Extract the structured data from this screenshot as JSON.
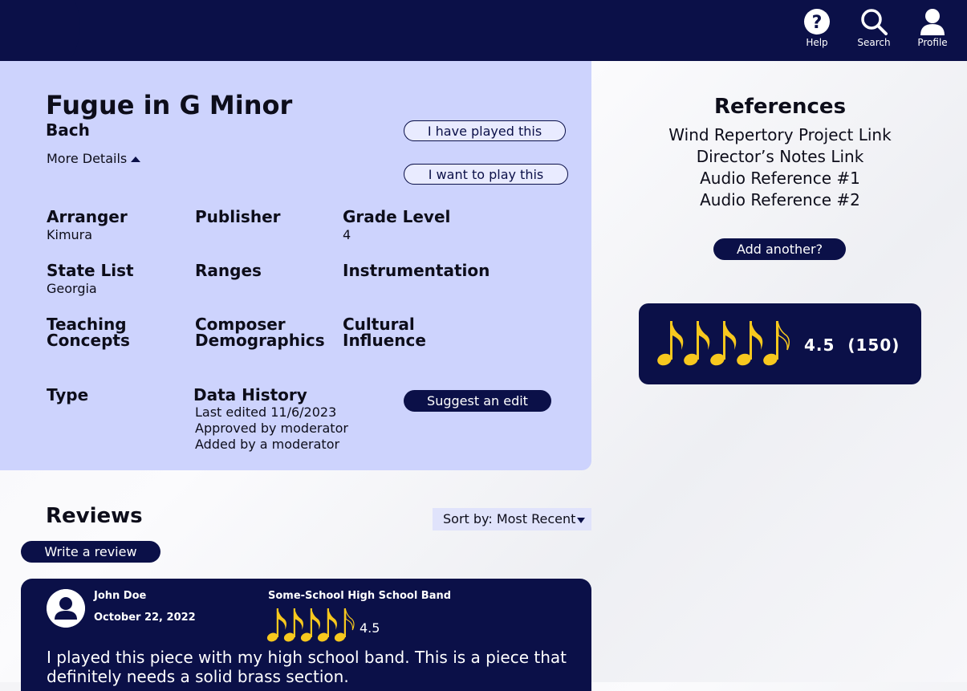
{
  "nav": {
    "help": "Help",
    "search": "Search",
    "profile": "Profile"
  },
  "piece": {
    "title": "Fugue in G Minor",
    "composer": "Bach",
    "more_details": "More Details",
    "played_label": "I have played this",
    "want_label": "I want to play this"
  },
  "fields": {
    "arranger": {
      "label": "Arranger",
      "value": "Kimura"
    },
    "publisher": {
      "label": "Publisher",
      "value": ""
    },
    "grade": {
      "label": "Grade Level",
      "value": "4"
    },
    "state_list": {
      "label": "State List",
      "value": "Georgia"
    },
    "ranges": {
      "label": "Ranges",
      "value": ""
    },
    "instrumentation": {
      "label": "Instrumentation",
      "value": ""
    },
    "teaching_line1": "Teaching",
    "teaching_line2": "Concepts",
    "composer_demo_line1": "Composer",
    "composer_demo_line2": "Demographics",
    "cultural_line1": "Cultural",
    "cultural_line2": "Influence",
    "type": {
      "label": "Type",
      "value": ""
    },
    "data_history": {
      "label": "Data History",
      "lines": [
        "Last edited 11/6/2023",
        "Approved by moderator",
        "Added by a moderator"
      ]
    },
    "suggest_edit": "Suggest an edit"
  },
  "references": {
    "title": "References",
    "links": [
      "Wind Repertory Project Link",
      "Director’s Notes Link",
      "Audio Reference #1",
      "Audio Reference #2"
    ],
    "add_label": "Add another?"
  },
  "rating": {
    "value": 4.5,
    "count_text": "(150)",
    "display": "4.5",
    "note_color": "#f7c81e"
  },
  "reviews": {
    "title": "Reviews",
    "sort_label": "Sort by: Most Recent",
    "write_label": "Write a review",
    "items": [
      {
        "name": "John Doe",
        "date": "October 22, 2022",
        "band": "Some-School High School Band",
        "rating": "4.5",
        "text": "I played this piece with my high school band. This is a piece that definitely needs a solid brass section."
      }
    ]
  },
  "colors": {
    "navy": "#0b1048",
    "panel": "#cdd3fd",
    "gold": "#f7c81e"
  }
}
